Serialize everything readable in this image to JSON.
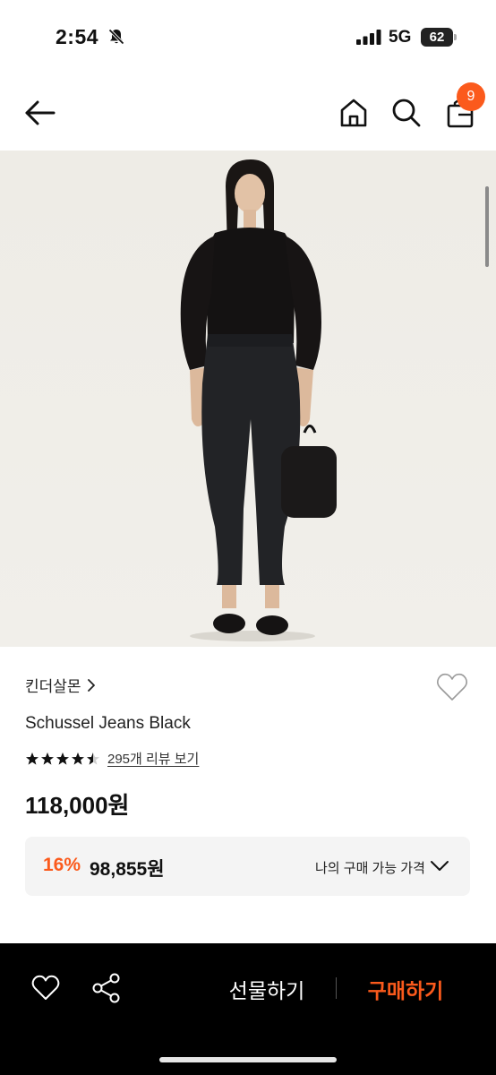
{
  "status_bar": {
    "time": "2:54",
    "network": "5G",
    "battery": "62"
  },
  "header": {
    "cart_count": "9",
    "icons": [
      "arrow-left-icon",
      "home-icon",
      "search-icon",
      "shopping-bag-icon",
      "bell-off-icon",
      "signal-icon"
    ]
  },
  "product": {
    "brand": "킨더살몬",
    "title": "Schussel Jeans Black",
    "rating": 4.5,
    "review_link": "295개 리뷰 보기",
    "price": "118,000원",
    "discount": {
      "rate": "16%",
      "price": "98,855원",
      "label": "나의 구매 가능 가격"
    }
  },
  "bottom_bar": {
    "gift_label": "선물하기",
    "buy_label": "구매하기",
    "icons": [
      "heart-icon",
      "share-icon"
    ]
  },
  "colors": {
    "accent": "#fb5a1c",
    "bottom_bar": "#000000",
    "discount_bg": "#f4f4f4"
  }
}
